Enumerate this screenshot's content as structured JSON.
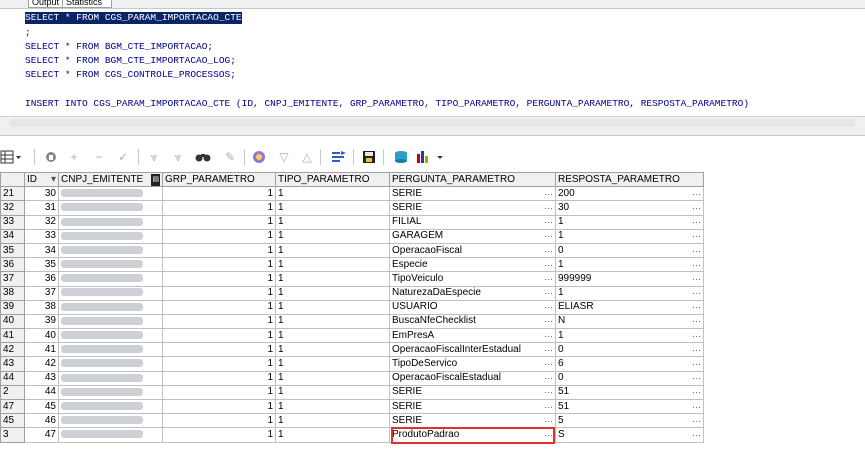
{
  "tabs": [
    {
      "label": "Output"
    },
    {
      "label": "Statistics"
    }
  ],
  "editor": {
    "lines": [
      {
        "text": "SELECT * FROM CGS_PARAM_IMPORTACAO_CTE",
        "selected": true
      },
      {
        "text": ";",
        "selected": false
      },
      {
        "text": "SELECT * FROM BGM_CTE_IMPORTACAO;",
        "selected": false
      },
      {
        "text": "SELECT * FROM BGM_CTE_IMPORTACAO_LOG;",
        "selected": false
      },
      {
        "text": "SELECT * FROM CGS_CONTROLE_PROCESSOS;",
        "selected": false
      },
      {
        "text": "INSERT INTO CGS_PARAM_IMPORTACAO_CTE (ID, CNPJ_EMITENTE, GRP_PARAMETRO, TIPO_PARAMETRO, PERGUNTA_PARAMETRO, RESPOSTA_PARAMETRO)",
        "selected": false
      }
    ]
  },
  "toolbar": {
    "icons": [
      "grid-menu-icon",
      "lock-icon",
      "add-record-icon",
      "delete-record-icon",
      "post-icon",
      "filter-icon",
      "clear-filter-icon",
      "find-icon",
      "clear-icon",
      "query-by-example-icon",
      "previous-icon",
      "next-icon",
      "refresh-icon",
      "save-icon",
      "export-icon",
      "chart-icon"
    ]
  },
  "grid": {
    "columns": [
      "ID",
      "CNPJ_EMITENTE",
      "GRP_PARAMETRO",
      "TIPO_PARAMETRO",
      "PERGUNTA_PARAMETRO",
      "RESPOSTA_PARAMETRO"
    ],
    "rows": [
      {
        "rn": "21",
        "id": "30",
        "grp": "1",
        "tipo": "1",
        "pergunta": "SERIE",
        "resposta": "200"
      },
      {
        "rn": "32",
        "id": "31",
        "grp": "1",
        "tipo": "1",
        "pergunta": "SERIE",
        "resposta": "30"
      },
      {
        "rn": "33",
        "id": "32",
        "grp": "1",
        "tipo": "1",
        "pergunta": "FILIAL",
        "resposta": "1"
      },
      {
        "rn": "34",
        "id": "33",
        "grp": "1",
        "tipo": "1",
        "pergunta": "GARAGEM",
        "resposta": "1"
      },
      {
        "rn": "35",
        "id": "34",
        "grp": "1",
        "tipo": "1",
        "pergunta": "OperacaoFiscal",
        "resposta": "0"
      },
      {
        "rn": "36",
        "id": "35",
        "grp": "1",
        "tipo": "1",
        "pergunta": "Especie",
        "resposta": "1"
      },
      {
        "rn": "37",
        "id": "36",
        "grp": "1",
        "tipo": "1",
        "pergunta": "TipoVeiculo",
        "resposta": "999999"
      },
      {
        "rn": "38",
        "id": "37",
        "grp": "1",
        "tipo": "1",
        "pergunta": "NaturezaDaEspecie",
        "resposta": "1"
      },
      {
        "rn": "39",
        "id": "38",
        "grp": "1",
        "tipo": "1",
        "pergunta": "USUARIO",
        "resposta": "ELIASR"
      },
      {
        "rn": "40",
        "id": "39",
        "grp": "1",
        "tipo": "1",
        "pergunta": "BuscaNfeChecklist",
        "resposta": "N"
      },
      {
        "rn": "41",
        "id": "40",
        "grp": "1",
        "tipo": "1",
        "pergunta": "EmPresA",
        "resposta": "1"
      },
      {
        "rn": "42",
        "id": "41",
        "grp": "1",
        "tipo": "1",
        "pergunta": "OperacaoFiscalInterEstadual",
        "resposta": "0"
      },
      {
        "rn": "43",
        "id": "42",
        "grp": "1",
        "tipo": "1",
        "pergunta": "TipoDeServico",
        "resposta": "6"
      },
      {
        "rn": "44",
        "id": "43",
        "grp": "1",
        "tipo": "1",
        "pergunta": "OperacaoFiscalEstadual",
        "resposta": "0"
      },
      {
        "rn": "2",
        "id": "44",
        "grp": "1",
        "tipo": "1",
        "pergunta": "SERIE",
        "resposta": "51"
      },
      {
        "rn": "47",
        "id": "45",
        "grp": "1",
        "tipo": "1",
        "pergunta": "SERIE",
        "resposta": "51"
      },
      {
        "rn": "45",
        "id": "46",
        "grp": "1",
        "tipo": "1",
        "pergunta": "SERIE",
        "resposta": "5"
      },
      {
        "rn": "3",
        "id": "47",
        "grp": "1",
        "tipo": "1",
        "pergunta": "ProdutoPadrao",
        "resposta": "S"
      }
    ],
    "ellipsis": "···",
    "highlight_color": "#e03030"
  }
}
